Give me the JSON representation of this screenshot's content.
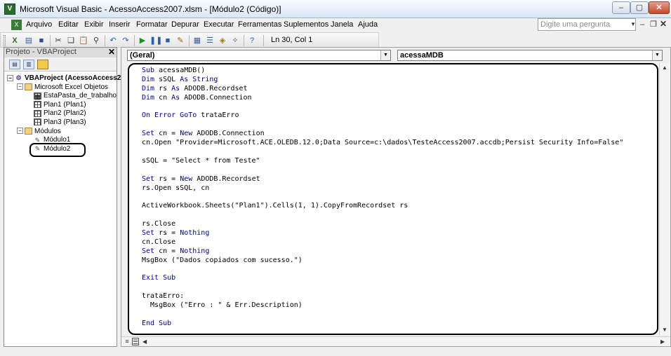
{
  "window": {
    "title": "Microsoft Visual Basic - AcessoAccess2007.xlsm - [Módulo2 (Código)]",
    "min": "–",
    "max": "▢",
    "close": "✕"
  },
  "menu": {
    "items": [
      "Arquivo",
      "Editar",
      "Exibir",
      "Inserir",
      "Formatar",
      "Depurar",
      "Executar",
      "Ferramentas",
      "Suplementos",
      "Janela",
      "Ajuda"
    ],
    "help_placeholder": "Digite uma pergunta"
  },
  "toolbar": {
    "position": "Ln 30, Col 1",
    "icons": [
      "excel-icon",
      "insert-module-icon",
      "save-icon",
      "cut-icon",
      "copy-icon",
      "paste-icon",
      "find-icon",
      "undo-icon",
      "redo-icon",
      "run-icon",
      "break-icon",
      "reset-icon",
      "design-mode-icon",
      "project-explorer-icon",
      "properties-icon",
      "object-browser-icon",
      "toolbox-icon",
      "help-icon"
    ]
  },
  "project": {
    "header": "Projeto - VBAProject",
    "close": "✕",
    "tree": [
      {
        "label": "VBAProject (AcessoAccess2",
        "level": 0,
        "icon": "vbproject-icon",
        "bold": true,
        "expand": "−"
      },
      {
        "label": "Microsoft Excel Objetos",
        "level": 1,
        "icon": "folder-icon",
        "expand": "−"
      },
      {
        "label": "EstaPasta_de_trabalho",
        "level": 2,
        "icon": "workbook-icon"
      },
      {
        "label": "Plan1 (Plan1)",
        "level": 2,
        "icon": "sheet-icon"
      },
      {
        "label": "Plan2 (Plan2)",
        "level": 2,
        "icon": "sheet-icon"
      },
      {
        "label": "Plan3 (Plan3)",
        "level": 2,
        "icon": "sheet-icon"
      },
      {
        "label": "Módulos",
        "level": 1,
        "icon": "folder-icon",
        "expand": "−"
      },
      {
        "label": "Módulo1",
        "level": 2,
        "icon": "module-icon"
      },
      {
        "label": "Módulo2",
        "level": 2,
        "icon": "module-icon"
      }
    ]
  },
  "code": {
    "object_combo": "(Geral)",
    "procedure_combo": "acessaMDB",
    "lines": [
      [
        {
          "t": "Sub ",
          "k": true
        },
        {
          "t": "acessaMDB()"
        }
      ],
      [
        {
          "t": "Dim ",
          "k": true
        },
        {
          "t": "sSQL "
        },
        {
          "t": "As String",
          "k": true
        }
      ],
      [
        {
          "t": "Dim ",
          "k": true
        },
        {
          "t": "rs "
        },
        {
          "t": "As ",
          "k": true
        },
        {
          "t": "ADODB.Recordset"
        }
      ],
      [
        {
          "t": "Dim ",
          "k": true
        },
        {
          "t": "cn "
        },
        {
          "t": "As ",
          "k": true
        },
        {
          "t": "ADODB.Connection"
        }
      ],
      [],
      [
        {
          "t": "On Error GoTo ",
          "k": true
        },
        {
          "t": "trataErro"
        }
      ],
      [],
      [
        {
          "t": "Set ",
          "k": true
        },
        {
          "t": "cn = "
        },
        {
          "t": "New ",
          "k": true
        },
        {
          "t": "ADODB.Connection"
        }
      ],
      [
        {
          "t": "cn.Open \"Provider=Microsoft.ACE.OLEDB.12.0;Data Source=c:\\dados\\TesteAccess2007.accdb;Persist Security Info=False\""
        }
      ],
      [],
      [
        {
          "t": "sSQL = \"Select * from Teste\""
        }
      ],
      [],
      [
        {
          "t": "Set ",
          "k": true
        },
        {
          "t": "rs = "
        },
        {
          "t": "New ",
          "k": true
        },
        {
          "t": "ADODB.Recordset"
        }
      ],
      [
        {
          "t": "rs.Open sSQL, cn"
        }
      ],
      [],
      [
        {
          "t": "ActiveWorkbook.Sheets(\"Plan1\").Cells(1, 1).CopyFromRecordset rs"
        }
      ],
      [],
      [
        {
          "t": "rs.Close"
        }
      ],
      [
        {
          "t": "Set ",
          "k": true
        },
        {
          "t": "rs = "
        },
        {
          "t": "Nothing",
          "k": true
        }
      ],
      [
        {
          "t": "cn.Close"
        }
      ],
      [
        {
          "t": "Set ",
          "k": true
        },
        {
          "t": "cn = "
        },
        {
          "t": "Nothing",
          "k": true
        }
      ],
      [
        {
          "t": "MsgBox (\"Dados copiados com sucesso.\")"
        }
      ],
      [],
      [
        {
          "t": "Exit Sub",
          "k": true
        }
      ],
      [],
      [
        {
          "t": "trataErro:"
        }
      ],
      [
        {
          "t": "  MsgBox (\"Erro : \" & Err.Description)"
        }
      ],
      [],
      [
        {
          "t": "End Sub",
          "k": true
        }
      ]
    ]
  }
}
